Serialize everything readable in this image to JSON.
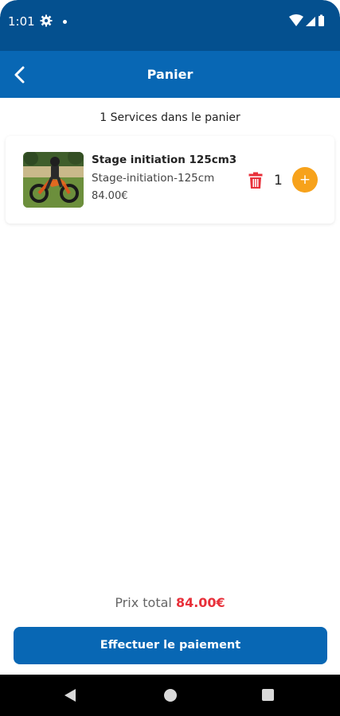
{
  "status_bar": {
    "time": "1:01",
    "background": "#04508f",
    "icons": [
      "gear-icon",
      "notification-dot-icon",
      "wifi-icon",
      "cell-signal-icon",
      "battery-icon"
    ]
  },
  "app_bar": {
    "title": "Panier",
    "background": "#0867b4",
    "back_icon": "chevron-left-icon"
  },
  "cart": {
    "count_text": "1 Services dans le panier",
    "items": [
      {
        "name": "Stage initiation 125cm3",
        "reference": "Stage-initiation-125cm",
        "price": "84.00€",
        "quantity": "1",
        "add_label": "+",
        "thumbnail": "motocross-rider-photo"
      }
    ]
  },
  "footer": {
    "total_label": "Prix total",
    "total_value": "84.00€",
    "total_color": "#e8303a",
    "pay_button_label": "Effectuer le paiement"
  },
  "colors": {
    "primary": "#0867b4",
    "accent": "#f7a21b",
    "danger": "#e8303a"
  }
}
